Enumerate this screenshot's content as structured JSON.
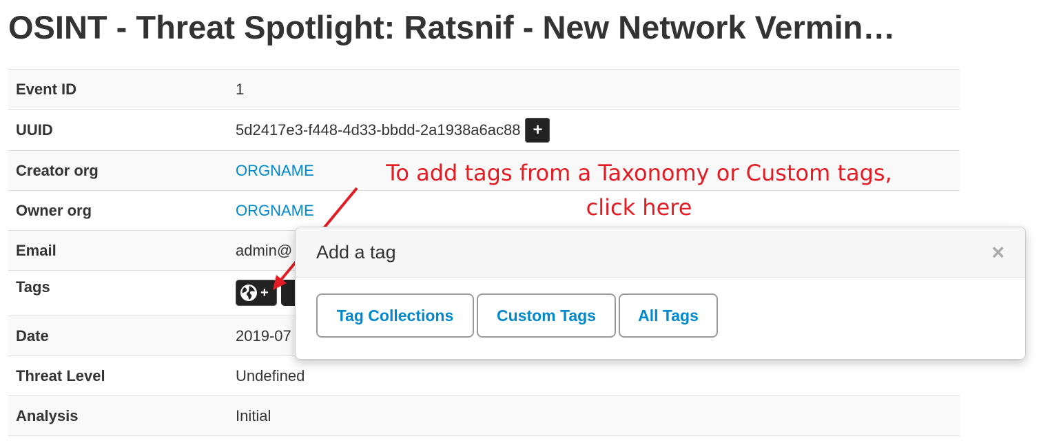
{
  "event": {
    "title": "OSINT - Threat Spotlight: Ratsnif - New Network Vermin…"
  },
  "details": [
    {
      "key": "Event ID",
      "value": "1"
    },
    {
      "key": "UUID",
      "value": "5d2417e3-f448-4d33-bbdd-2a1938a6ac88"
    },
    {
      "key": "Creator org",
      "value": "ORGNAME"
    },
    {
      "key": "Owner org",
      "value": "ORGNAME"
    },
    {
      "key": "Email",
      "value": "admin@"
    },
    {
      "key": "Tags",
      "value": ""
    },
    {
      "key": "Date",
      "value": "2019-07"
    },
    {
      "key": "Threat Level",
      "value": "Undefined"
    },
    {
      "key": "Analysis",
      "value": "Initial"
    }
  ],
  "uuid_button_label": "+",
  "tags_button": {
    "icon": "globe-icon",
    "label": "+"
  },
  "annotation": {
    "line1": "To add tags from a Taxonomy or Custom tags,",
    "line2": "click here",
    "color": "#e31b23"
  },
  "popover": {
    "title": "Add a tag",
    "close_label": "×",
    "buttons": [
      "Tag Collections",
      "Custom Tags",
      "All Tags"
    ]
  },
  "colors": {
    "link": "#0088cc",
    "text": "#333333",
    "arrow": "#e31b23"
  }
}
